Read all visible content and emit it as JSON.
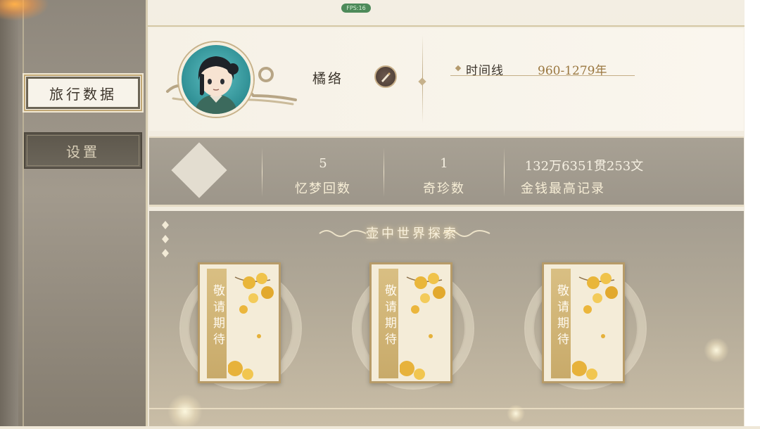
{
  "fps_badge": "FPS:16",
  "sidebar": {
    "tabs": [
      {
        "label": "旅行数据",
        "active": true
      },
      {
        "label": "设置",
        "active": false
      }
    ]
  },
  "profile": {
    "name": "橘络",
    "edit_icon": "brush-icon",
    "timeline_label": "时间线",
    "timeline_value": "960-1279年"
  },
  "stats": [
    {
      "value": "5",
      "label": "忆梦回数"
    },
    {
      "value": "1",
      "label": "奇珍数"
    },
    {
      "value": "132万6351贯253文",
      "label": "金钱最高记录"
    }
  ],
  "explore": {
    "title": "壶中世界探索",
    "cards": [
      {
        "text": "敬请期待"
      },
      {
        "text": "敬请期待"
      },
      {
        "text": "敬请期待"
      }
    ]
  },
  "colors": {
    "accent_gold": "#9a7740",
    "panel_light": "#f6f1e6",
    "band_gray": "#a8a194"
  }
}
